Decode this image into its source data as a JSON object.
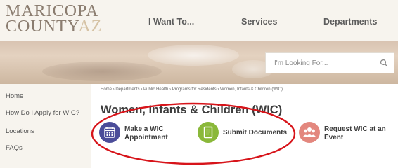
{
  "logo": {
    "line1": "MARICOPA",
    "line2_main": "COUNTY",
    "line2_suffix": "AZ"
  },
  "nav": {
    "items": [
      "I Want To...",
      "Services",
      "Departments"
    ]
  },
  "search": {
    "placeholder": "I'm Looking For..."
  },
  "sidebar": {
    "items": [
      "Home",
      "How Do I Apply for WIC?",
      "Locations",
      "FAQs"
    ]
  },
  "breadcrumb": "Home › Departments › Public Health › Programs for Residents › Women, Infants & Children (WIC)",
  "page_title": "Women, Infants & Children (WIC)",
  "actions": [
    {
      "line1": "Make a WIC",
      "line2": "Appointment",
      "icon": "calendar-icon",
      "color": "#4b4d99"
    },
    {
      "line1": "Submit Documents",
      "line2": "",
      "icon": "document-icon",
      "color": "#8ab83a"
    },
    {
      "line1": "Request WIC at an",
      "line2": "Event",
      "icon": "people-icon",
      "color": "#e3877e"
    }
  ],
  "colors": {
    "header_bg": "#f7f4ee",
    "annotation_ellipse": "#d7141a"
  }
}
